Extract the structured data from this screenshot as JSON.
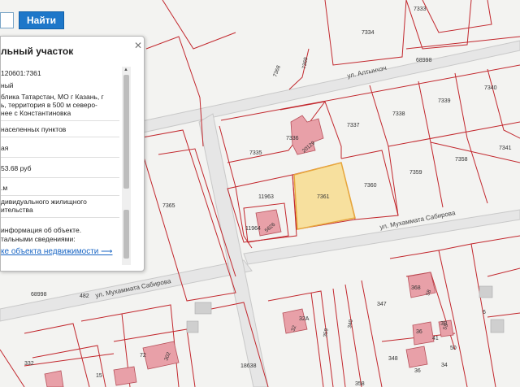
{
  "search": {
    "button_label": "Найти"
  },
  "panel": {
    "title": "льный участок",
    "close_symbol": "✕",
    "rows": [
      "120601:7361",
      "ный",
      "блика Татарстан, МО г Казань, г",
      "ь, территория в 500 м северо-",
      "нее с Константиновка",
      "населенных пунктов",
      "ая",
      "53.68 руб",
      ".м",
      "дивидуального жилищного",
      "ительства",
      "информация об объекте.",
      "тальными сведениями:"
    ],
    "link_text": "ке объекта недвижимости ⟶"
  },
  "map": {
    "streets": {
      "altynchach": "ул. Алтынчэч",
      "sabirova_1": "ул. Мухаммата Сабирова",
      "sabirova_2": "ул. Мухаммата Сабирова"
    },
    "parcel_labels": [
      "7333",
      "7334",
      "68998",
      "7368",
      "7369",
      "7340",
      "7339",
      "7338",
      "7337",
      "7336",
      "20129",
      "7335",
      "7341",
      "7358",
      "7359",
      "7360",
      "7361",
      "11963",
      "7365",
      "11964",
      "5626",
      "68998",
      "482",
      "368",
      "58",
      "6",
      "347",
      "32",
      "359",
      "340",
      "36",
      "55",
      "36",
      "41",
      "34",
      "52",
      "50",
      "332",
      "72",
      "302",
      "18638",
      "348",
      "15",
      "35",
      "36",
      "52",
      "348",
      "358",
      "32A",
      "3B",
      "13A"
    ],
    "highlight_color": "#f8d77a"
  }
}
